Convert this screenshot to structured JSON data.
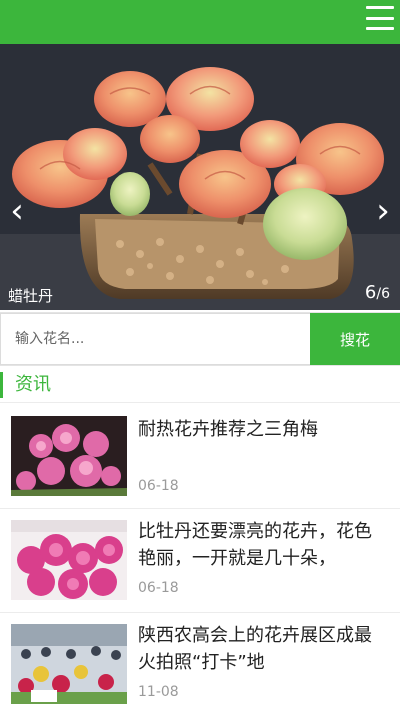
{
  "banner": {
    "caption": "蜡牡丹",
    "counter_current": "6",
    "counter_total": "/6",
    "prev_label": "‹",
    "next_label": "›"
  },
  "search": {
    "placeholder": "输入花名...",
    "button_label": "搜花"
  },
  "section": {
    "title": "资讯"
  },
  "news": [
    {
      "title": "耐热花卉推荐之三角梅",
      "date": "06-18"
    },
    {
      "title": "比牡丹还要漂亮的花卉，花色艳丽，一开就是几十朵，",
      "date": "06-18"
    },
    {
      "title": "陕西农高会上的花卉展区成最火拍照“打卡”地",
      "date": "11-08"
    }
  ],
  "colors": {
    "brand_green": "#3cb63c",
    "date_gray": "#9a9a9a"
  }
}
